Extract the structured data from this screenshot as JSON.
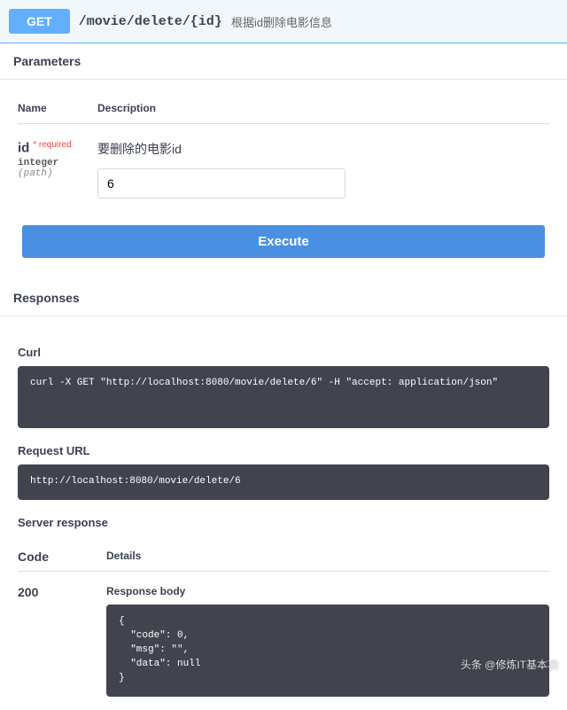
{
  "header": {
    "method": "GET",
    "path": "/movie/delete/{id}",
    "summary": "根据id删除电影信息"
  },
  "parameters": {
    "section_title": "Parameters",
    "columns": {
      "name": "Name",
      "description": "Description"
    },
    "items": [
      {
        "name": "id",
        "required_label": "* required",
        "type": "integer",
        "in": "(path)",
        "description": "要删除的电影id",
        "value": "6"
      }
    ]
  },
  "execute": {
    "label": "Execute"
  },
  "responses": {
    "section_title": "Responses",
    "curl": {
      "label": "Curl",
      "content": "curl -X GET \"http://localhost:8080/movie/delete/6\" -H \"accept: application/json\""
    },
    "request_url": {
      "label": "Request URL",
      "content": "http://localhost:8080/movie/delete/6"
    },
    "server_response_label": "Server response",
    "columns": {
      "code": "Code",
      "details": "Details"
    },
    "entries": [
      {
        "code": "200",
        "body_label": "Response body",
        "body": "{\n  \"code\": 0,\n  \"msg\": \"\",\n  \"data\": null\n}"
      }
    ]
  },
  "watermark": "头条 @修炼IT基本功"
}
